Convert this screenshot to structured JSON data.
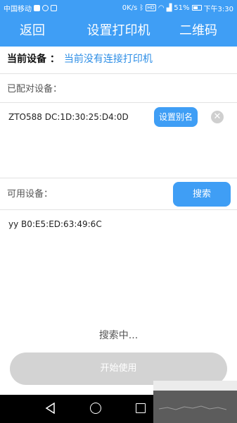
{
  "statusbar": {
    "carrier": "中国移动",
    "network_speed": "0K/s",
    "network_type": "HD",
    "battery": "51%",
    "time": "下午3:30"
  },
  "appbar": {
    "back_label": "返回",
    "title": "设置打印机",
    "qr_label": "二维码"
  },
  "current_device": {
    "label": "当前设备 ：",
    "value": "当前没有连接打印机"
  },
  "paired": {
    "label": "已配对设备：",
    "devices": [
      {
        "name": "ZTO588 DC:1D:30:25:D4:0D",
        "alias_button": "设置别名",
        "remove_icon": "✕"
      }
    ]
  },
  "available": {
    "label": "可用设备：",
    "search_button": "搜索",
    "devices": [
      {
        "name": "yy B0:E5:ED:63:49:6C"
      }
    ]
  },
  "search_status": "搜索中...",
  "start_button": "开始使用",
  "colors": {
    "accent": "#3f9ef5",
    "link": "#2d8ee6",
    "disabled": "#d3d3d3"
  }
}
